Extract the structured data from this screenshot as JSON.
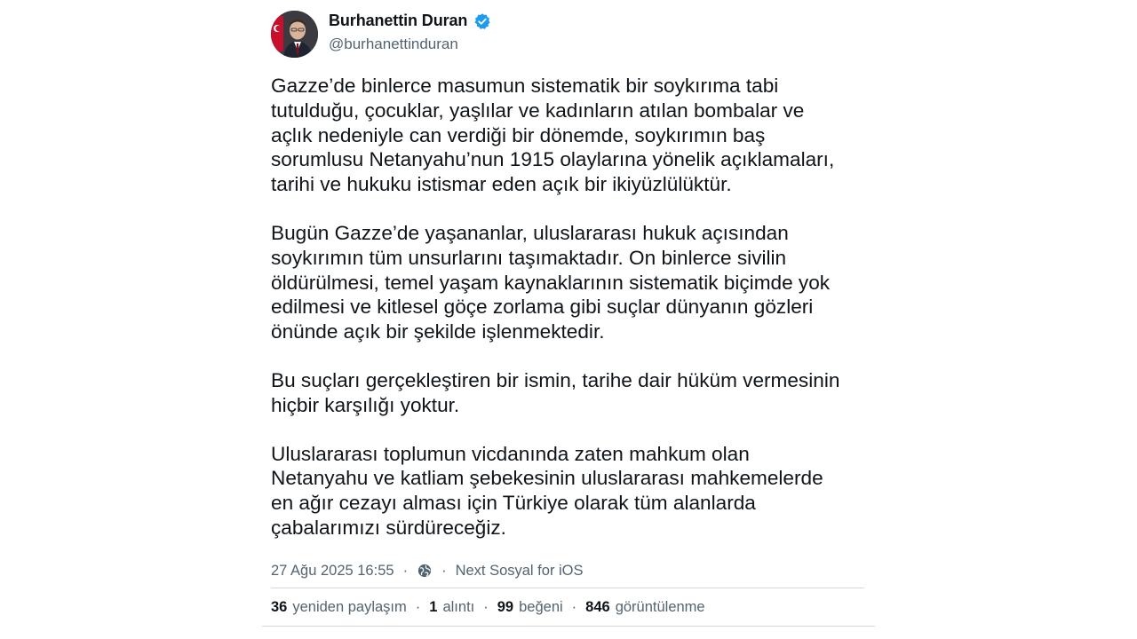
{
  "author": {
    "display_name": "Burhanettin Duran",
    "handle": "@burhanettinduran",
    "verified": true
  },
  "post": {
    "paragraphs": [
      "Gazze’de binlerce masumun sistematik bir soykırıma tabi\ntutulduğu, çocuklar, yaşlılar ve kadınların atılan bombalar ve\naçlık nedeniyle can verdiği bir dönemde, soykırımın baş\nsorumlusu Netanyahu’nun 1915 olaylarına yönelik açıklamaları,\ntarihi ve hukuku istismar eden açık bir ikiyüzlülüktür.",
      "Bugün Gazze’de yaşananlar, uluslararası hukuk açısından\nsoykırımın tüm unsurlarını taşımaktadır. On binlerce sivilin\nöldürülmesi, temel yaşam kaynaklarının sistematik biçimde yok\nedilmesi ve kitlesel göçe zorlama gibi suçlar dünyanın gözleri\nönünde açık bir şekilde işlenmektedir.",
      "Bu suçları gerçekleştiren bir ismin, tarihe dair hüküm vermesinin\nhiçbir karşılığı yoktur.",
      "Uluslararası toplumun vicdanında zaten mahkum olan\nNetanyahu ve katliam şebekesinin uluslararası mahkemelerde\nen ağır cezayı alması için Türkiye olarak tüm alanlarda\nçabalarımızı sürdüreceğiz."
    ]
  },
  "meta": {
    "timestamp": "27 Ağu 2025 16:55",
    "separator": "·",
    "visibility_icon": "globe-icon",
    "client": "Next Sosyal for iOS"
  },
  "stats": {
    "reposts_count": "36",
    "reposts_label": "yeniden paylaşım",
    "quotes_count": "1",
    "quotes_label": "alıntı",
    "likes_count": "99",
    "likes_label": "beğeni",
    "views_count": "846",
    "views_label": "görüntülenme",
    "separator": "·"
  },
  "colors": {
    "text_primary": "#0f1419",
    "text_secondary": "#536471",
    "verified_blue": "#1d9bf0",
    "divider": "#cfd9de"
  }
}
